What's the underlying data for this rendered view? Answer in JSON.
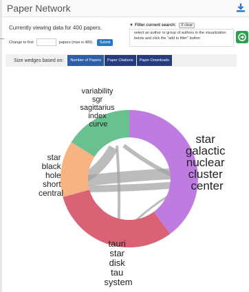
{
  "header": {
    "title": "Paper Network",
    "download_icon": "download-icon"
  },
  "controls": {
    "viewing_text": "Currently viewing data for 400 papers.",
    "change_prefix": "Change to first",
    "change_value": "",
    "change_suffix": "papers (max is 489).",
    "submit_label": "Submit"
  },
  "filter": {
    "icon": "filter-icon",
    "title": "Filter current search:",
    "clear_label": "X clear",
    "help_text": "select an author or group of authors in the visualization below and click the \"add to filter\" button",
    "add_icon": "arrow-circle-right-icon"
  },
  "sizing": {
    "label": "Size wedges based on:",
    "options": [
      "Number of Papers",
      "Paper Citations",
      "Paper Downloads"
    ],
    "selected": "Number of Papers"
  },
  "network": {
    "groups": [
      {
        "words": [
          "variability",
          "sgr",
          "sagittarius",
          "index",
          "curve"
        ],
        "color": "#6ac18f"
      },
      {
        "words": [
          "star",
          "galactic",
          "nuclear",
          "cluster",
          "center"
        ],
        "color": "#bf7ce0"
      },
      {
        "words": [
          "tauri",
          "star",
          "disk",
          "tau",
          "system"
        ],
        "color": "#d96275"
      },
      {
        "words": [
          "star",
          "black",
          "hole",
          "short",
          "central"
        ],
        "color": "#f7b482"
      }
    ],
    "link_color": "#a0a0a0"
  }
}
